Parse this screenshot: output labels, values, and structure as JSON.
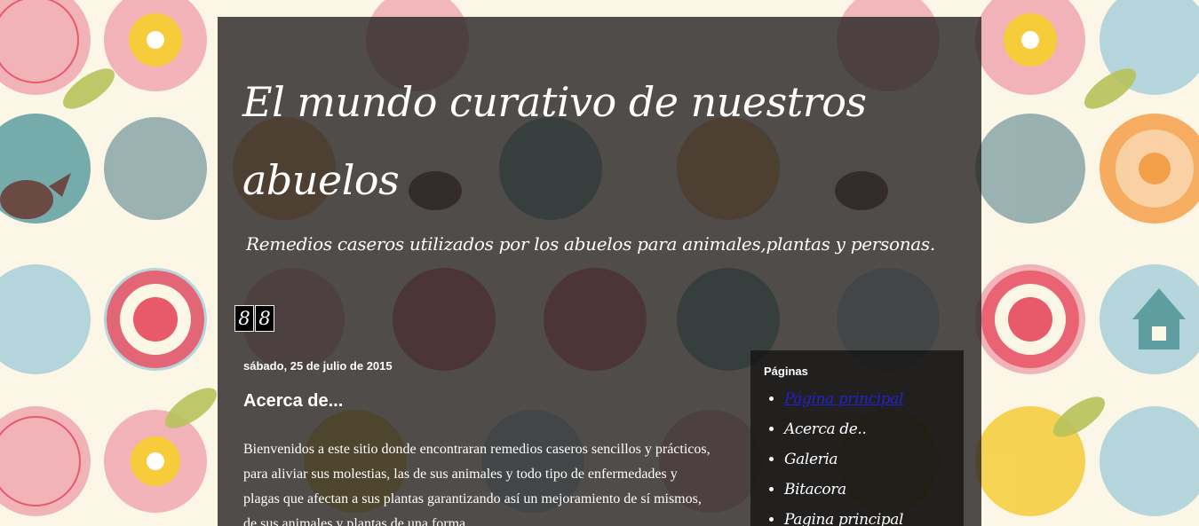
{
  "blog": {
    "title": "El mundo curativo de nuestros abuelos",
    "description": "Remedios caseros utilizados por los abuelos para animales,plantas y personas."
  },
  "counter": {
    "digits": [
      "8",
      "8"
    ]
  },
  "post": {
    "date": "sábado, 25 de julio de 2015",
    "title": "Acerca de...",
    "body": "Bienvenidos a este sitio donde encontraran remedios caseros sencillos y prácticos, para  aliviar sus  molestias, las de sus animales y  todo tipo de enfermedades y plagas que afectan a sus plantas  garantizando así un mejoramiento de  sí mismos, de sus animales y plantas de una forma"
  },
  "sidebar": {
    "heading": "Páginas",
    "pages": [
      {
        "label": "Página principal",
        "active": true
      },
      {
        "label": "Acerca de..",
        "active": false
      },
      {
        "label": "Galeria",
        "active": false
      },
      {
        "label": "Bitacora",
        "active": false
      },
      {
        "label": "Pagina principal",
        "active": false
      }
    ]
  },
  "colors": {
    "background": "#fbf6e6",
    "overlay": "#282626",
    "sidebar_panel": "#0f0f0f",
    "active_link": "#2222cc",
    "pink": "#f0a8b0",
    "teal": "#5e9ea0",
    "red": "#e85a6a",
    "yellow": "#f6cc3a",
    "orange": "#f4a04a",
    "light_blue": "#a8d0da",
    "olive": "#b7c35a",
    "brown": "#6b4a44"
  }
}
